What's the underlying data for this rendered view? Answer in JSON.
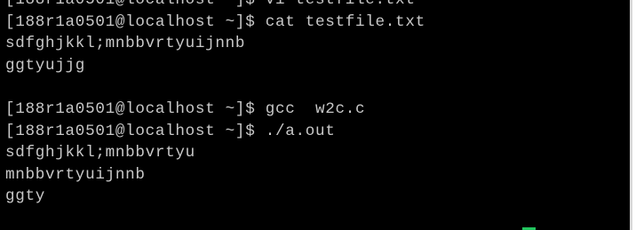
{
  "terminal": {
    "lines": [
      "[188r1a0501@localhost ~]$ vi testfile.txt",
      "[188r1a0501@localhost ~]$ cat testfile.txt",
      "sdfghjkkl;mnbbvrtyuijnnb",
      "ggtyujjg",
      "",
      "[188r1a0501@localhost ~]$ gcc  w2c.c",
      "[188r1a0501@localhost ~]$ ./a.out",
      "sdfghjkkl;mnbbvrtyu",
      "mnbbvrtyuijnnb",
      "ggty"
    ]
  },
  "colors": {
    "background": "#000000",
    "text": "#c8c8c8",
    "cursor": "#22c55e"
  }
}
